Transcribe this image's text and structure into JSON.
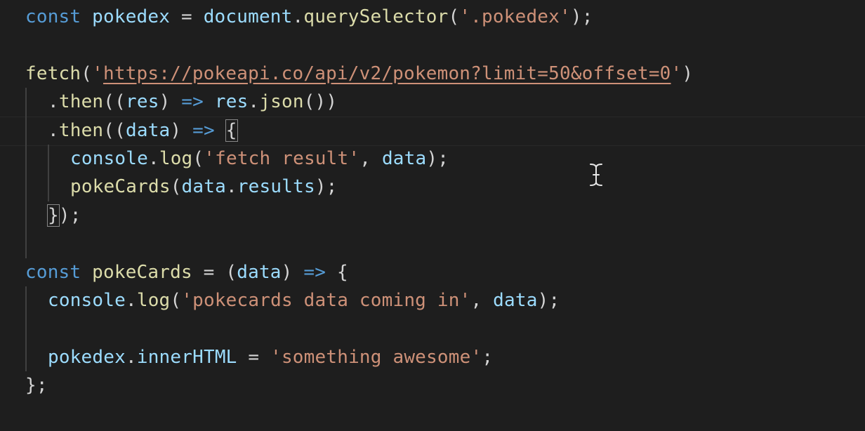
{
  "theme": {
    "background": "#1e1e1e",
    "keyword": "#569cd6",
    "variable": "#9cdcfe",
    "function": "#dcdcaa",
    "string": "#ce9178",
    "punctuation": "#d4d4d4"
  },
  "lines": [
    {
      "indent": 0,
      "tokens": [
        {
          "t": "keyword",
          "v": "const"
        },
        {
          "t": "punct",
          "v": " "
        },
        {
          "t": "variable",
          "v": "pokedex"
        },
        {
          "t": "operator",
          "v": " = "
        },
        {
          "t": "variable",
          "v": "document"
        },
        {
          "t": "punct",
          "v": "."
        },
        {
          "t": "function",
          "v": "querySelector"
        },
        {
          "t": "punct",
          "v": "("
        },
        {
          "t": "string",
          "v": "'.pokedex'"
        },
        {
          "t": "punct",
          "v": ");"
        }
      ]
    },
    {
      "indent": 0,
      "tokens": []
    },
    {
      "indent": 0,
      "tokens": [
        {
          "t": "function",
          "v": "fetch"
        },
        {
          "t": "punct",
          "v": "("
        },
        {
          "t": "string",
          "v": "'"
        },
        {
          "t": "url",
          "v": "https://pokeapi.co/api/v2/pokemon?limit=50&offset=0"
        },
        {
          "t": "string",
          "v": "'"
        },
        {
          "t": "punct",
          "v": ")"
        }
      ]
    },
    {
      "indent": 1,
      "tokens": [
        {
          "t": "punct",
          "v": "."
        },
        {
          "t": "function",
          "v": "then"
        },
        {
          "t": "punct",
          "v": "(("
        },
        {
          "t": "variable",
          "v": "res"
        },
        {
          "t": "punct",
          "v": ") "
        },
        {
          "t": "keyword",
          "v": "=>"
        },
        {
          "t": "punct",
          "v": " "
        },
        {
          "t": "variable",
          "v": "res"
        },
        {
          "t": "punct",
          "v": "."
        },
        {
          "t": "function",
          "v": "json"
        },
        {
          "t": "punct",
          "v": "())"
        }
      ]
    },
    {
      "indent": 1,
      "tokens": [
        {
          "t": "punct",
          "v": "."
        },
        {
          "t": "function",
          "v": "then"
        },
        {
          "t": "punct",
          "v": "(("
        },
        {
          "t": "variable",
          "v": "data"
        },
        {
          "t": "punct",
          "v": ") "
        },
        {
          "t": "keyword",
          "v": "=>"
        },
        {
          "t": "punct",
          "v": " "
        },
        {
          "t": "bracket",
          "v": "{"
        }
      ]
    },
    {
      "indent": 2,
      "tokens": [
        {
          "t": "variable",
          "v": "console"
        },
        {
          "t": "punct",
          "v": "."
        },
        {
          "t": "function",
          "v": "log"
        },
        {
          "t": "punct",
          "v": "("
        },
        {
          "t": "string",
          "v": "'fetch result'"
        },
        {
          "t": "punct",
          "v": ", "
        },
        {
          "t": "variable",
          "v": "data"
        },
        {
          "t": "punct",
          "v": ");"
        }
      ]
    },
    {
      "indent": 2,
      "tokens": [
        {
          "t": "function",
          "v": "pokeCards"
        },
        {
          "t": "punct",
          "v": "("
        },
        {
          "t": "variable",
          "v": "data"
        },
        {
          "t": "punct",
          "v": "."
        },
        {
          "t": "variable",
          "v": "results"
        },
        {
          "t": "punct",
          "v": ");"
        }
      ]
    },
    {
      "indent": 1,
      "tokens": [
        {
          "t": "bracket",
          "v": "}"
        },
        {
          "t": "punct",
          "v": ");"
        }
      ]
    },
    {
      "indent": 1,
      "tokens": []
    },
    {
      "indent": 0,
      "tokens": [
        {
          "t": "keyword",
          "v": "const"
        },
        {
          "t": "punct",
          "v": " "
        },
        {
          "t": "function",
          "v": "pokeCards"
        },
        {
          "t": "operator",
          "v": " = "
        },
        {
          "t": "punct",
          "v": "("
        },
        {
          "t": "variable",
          "v": "data"
        },
        {
          "t": "punct",
          "v": ") "
        },
        {
          "t": "keyword",
          "v": "=>"
        },
        {
          "t": "punct",
          "v": " {"
        }
      ]
    },
    {
      "indent": 1,
      "tokens": [
        {
          "t": "variable",
          "v": "console"
        },
        {
          "t": "punct",
          "v": "."
        },
        {
          "t": "function",
          "v": "log"
        },
        {
          "t": "punct",
          "v": "("
        },
        {
          "t": "string",
          "v": "'pokecards data coming in'"
        },
        {
          "t": "punct",
          "v": ", "
        },
        {
          "t": "variable",
          "v": "data"
        },
        {
          "t": "punct",
          "v": ");"
        }
      ]
    },
    {
      "indent": 1,
      "tokens": []
    },
    {
      "indent": 1,
      "tokens": [
        {
          "t": "variable",
          "v": "pokedex"
        },
        {
          "t": "punct",
          "v": "."
        },
        {
          "t": "variable",
          "v": "innerHTML"
        },
        {
          "t": "operator",
          "v": " = "
        },
        {
          "t": "string",
          "v": "'something awesome'"
        },
        {
          "t": "punct",
          "v": ";"
        }
      ]
    },
    {
      "indent": 0,
      "tokens": [
        {
          "t": "punct",
          "v": "};"
        }
      ]
    }
  ],
  "cursor": {
    "icon": "text-cursor-icon"
  }
}
